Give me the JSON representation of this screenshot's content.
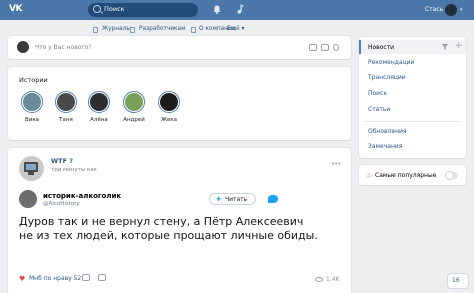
{
  "topbar": {
    "logo": "VK",
    "search_placeholder": "Поиск",
    "user_name": "Стась",
    "icons": [
      "bell-icon",
      "music-icon",
      "chevron-down-icon"
    ]
  },
  "nav": {
    "items": [
      {
        "label": "Журналы",
        "icon": "news-icon"
      },
      {
        "label": "Разработчикам",
        "icon": "dev-icon"
      },
      {
        "label": "О компании",
        "icon": "info-icon"
      },
      {
        "label": "Ещё ▾",
        "icon": ""
      }
    ]
  },
  "composer": {
    "placeholder": "Что у Вас нового?",
    "icons": [
      "camera-icon",
      "video-icon",
      "music-icon",
      "settings-icon"
    ]
  },
  "stories": {
    "title": "Истории",
    "items": [
      {
        "name": "Вика",
        "color": "#6a8a9b"
      },
      {
        "name": "Таня",
        "color": "#4a4a4a"
      },
      {
        "name": "Алёна",
        "color": "#2e2e2e"
      },
      {
        "name": "Андрей",
        "color": "#7aa158"
      },
      {
        "name": "Жека",
        "color": "#1d1d1d"
      }
    ]
  },
  "post": {
    "title": "WTF ?",
    "time": "три минуты как",
    "tweet": {
      "name": "историк-алкоголик",
      "handle": "@AlcoHistory",
      "follow_label": "Читать",
      "text": "Дуров так и не вернул стену, а Пётр Алексеевич не из тех людей, которые прощают личные обиды."
    },
    "footer": {
      "like_label": "Мнб по нраву 52",
      "views": "1.4K"
    }
  },
  "right_menu": {
    "items": [
      {
        "label": "Новости",
        "active": true
      },
      {
        "label": "Рекомендации"
      },
      {
        "label": "Трансляции"
      },
      {
        "label": "Поиск"
      },
      {
        "label": "Статьи"
      },
      {
        "label": "Обновления"
      },
      {
        "label": "Замечания"
      }
    ]
  },
  "popular": {
    "label": "Самые популярные",
    "enabled": false
  },
  "chat": {
    "count": "16"
  },
  "colors": {
    "brand": "#4a76a8",
    "link": "#2a5885",
    "background": "#edeef0"
  }
}
